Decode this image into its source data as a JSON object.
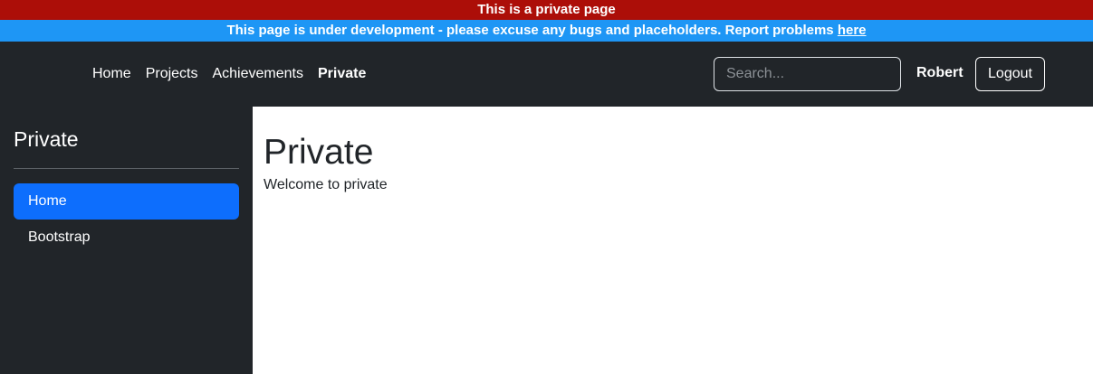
{
  "banners": {
    "private": "This is a private page",
    "dev_text": "This page is under development - please excuse any bugs and placeholders. Report problems ",
    "dev_link": "here"
  },
  "nav": {
    "links": [
      "Home",
      "Projects",
      "Achievements",
      "Private"
    ],
    "active": "Private",
    "search_placeholder": "Search...",
    "username": "Robert",
    "logout_label": "Logout"
  },
  "sidebar": {
    "title": "Private",
    "items": [
      {
        "label": "Home",
        "active": true
      },
      {
        "label": "Bootstrap",
        "active": false
      }
    ]
  },
  "main": {
    "title": "Private",
    "text": "Welcome to private"
  },
  "colors": {
    "private_banner": "#ac0e08",
    "dev_banner": "#1e96f5",
    "dark": "#212529",
    "accent": "#0d6efd"
  }
}
